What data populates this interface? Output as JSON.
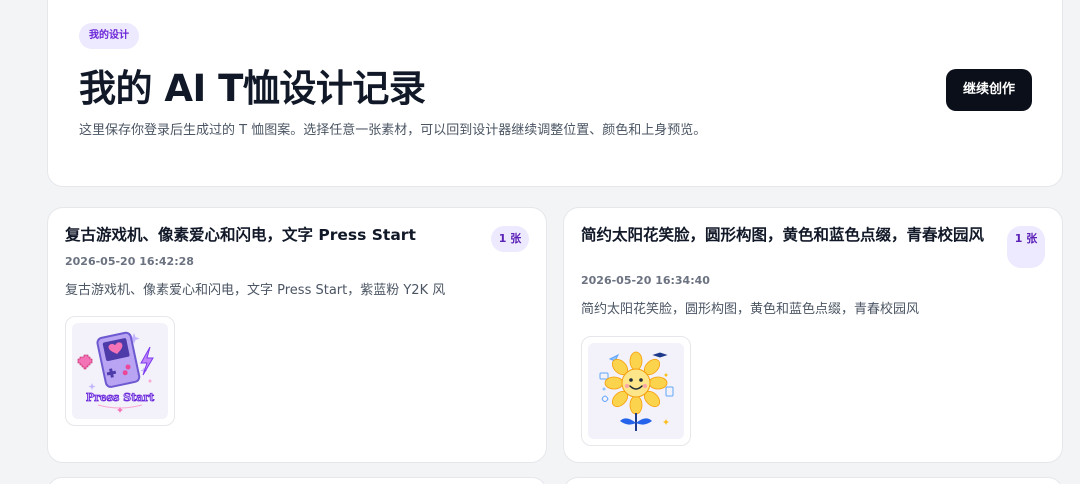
{
  "header": {
    "badge": "我的设计",
    "title": "我的 AI T恤设计记录",
    "description": "这里保存你登录后生成过的 T 恤图案。选择任意一张素材，可以回到设计器继续调整位置、颜色和上身预览。",
    "continue_label": "继续创作"
  },
  "records": [
    {
      "title": "复古游戏机、像素爱心和闪电，文字 Press Start",
      "count": "1 张",
      "date": "2026-05-20 16:42:28",
      "description": "复古游戏机、像素爱心和闪电，文字 Press Start，紫蓝粉 Y2K 风",
      "thumb_text": "Press Start"
    },
    {
      "title": "简约太阳花笑脸，圆形构图，黄色和蓝色点缀，青春校园风",
      "count": "1 张",
      "date": "2026-05-20 16:34:40",
      "description": "简约太阳花笑脸，圆形构图，黄色和蓝色点缀，青春校园风"
    }
  ],
  "colors": {
    "accent_bg": "#ede9fe",
    "accent_text": "#6d28d9",
    "button_bg": "#0b0f19"
  }
}
